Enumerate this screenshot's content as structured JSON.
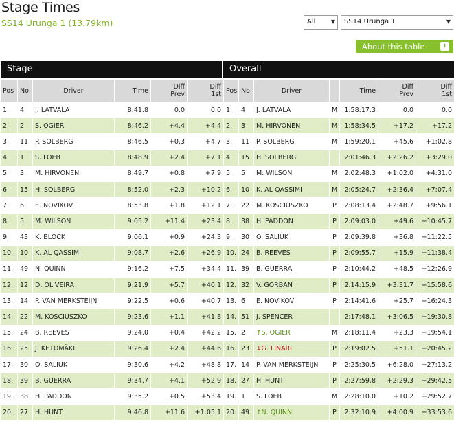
{
  "header": {
    "title": "Stage Times",
    "subtitle": "SS14 Urunga 1 (13.79km)",
    "filter_select": "All",
    "stage_select": "SS14 Urunga 1",
    "about_button": "About this table",
    "info_glyph": "i"
  },
  "stage_table": {
    "heading": "Stage",
    "columns": [
      "Pos",
      "No",
      "Driver",
      "Time",
      "Diff Prev",
      "Diff 1st"
    ],
    "rows": [
      {
        "pos": "1.",
        "no": "4",
        "driver": "J. LATVALA",
        "time": "8:41.8",
        "diff_prev": "0.0",
        "diff_first": "0.0"
      },
      {
        "pos": "2.",
        "no": "2",
        "driver": "S. OGIER",
        "time": "8:46.2",
        "diff_prev": "+4.4",
        "diff_first": "+4.4"
      },
      {
        "pos": "3.",
        "no": "11",
        "driver": "P. SOLBERG",
        "time": "8:46.5",
        "diff_prev": "+0.3",
        "diff_first": "+4.7"
      },
      {
        "pos": "4.",
        "no": "1",
        "driver": "S. LOEB",
        "time": "8:48.9",
        "diff_prev": "+2.4",
        "diff_first": "+7.1"
      },
      {
        "pos": "5.",
        "no": "3",
        "driver": "M. HIRVONEN",
        "time": "8:49.7",
        "diff_prev": "+0.8",
        "diff_first": "+7.9"
      },
      {
        "pos": "6.",
        "no": "15",
        "driver": "H. SOLBERG",
        "time": "8:52.0",
        "diff_prev": "+2.3",
        "diff_first": "+10.2"
      },
      {
        "pos": "7.",
        "no": "6",
        "driver": "E. NOVIKOV",
        "time": "8:53.8",
        "diff_prev": "+1.8",
        "diff_first": "+12.1"
      },
      {
        "pos": "8.",
        "no": "5",
        "driver": "M. WILSON",
        "time": "9:05.2",
        "diff_prev": "+11.4",
        "diff_first": "+23.4"
      },
      {
        "pos": "9.",
        "no": "43",
        "driver": "K. BLOCK",
        "time": "9:06.1",
        "diff_prev": "+0.9",
        "diff_first": "+24.3"
      },
      {
        "pos": "10.",
        "no": "10",
        "driver": "K. AL QASSIMI",
        "time": "9:08.7",
        "diff_prev": "+2.6",
        "diff_first": "+26.9"
      },
      {
        "pos": "11.",
        "no": "49",
        "driver": "N. QUINN",
        "time": "9:16.2",
        "diff_prev": "+7.5",
        "diff_first": "+34.4"
      },
      {
        "pos": "12.",
        "no": "12",
        "driver": "D. OLIVEIRA",
        "time": "9:21.9",
        "diff_prev": "+5.7",
        "diff_first": "+40.1"
      },
      {
        "pos": "13.",
        "no": "14",
        "driver": "P. VAN MERKSTEIJN",
        "time": "9:22.5",
        "diff_prev": "+0.6",
        "diff_first": "+40.7"
      },
      {
        "pos": "14.",
        "no": "22",
        "driver": "M. KOSCIUSZKO",
        "time": "9:23.6",
        "diff_prev": "+1.1",
        "diff_first": "+41.8"
      },
      {
        "pos": "15.",
        "no": "24",
        "driver": "B. REEVES",
        "time": "9:24.0",
        "diff_prev": "+0.4",
        "diff_first": "+42.2"
      },
      {
        "pos": "16.",
        "no": "25",
        "driver": "J. KETOMÄKI",
        "time": "9:26.4",
        "diff_prev": "+2.4",
        "diff_first": "+44.6"
      },
      {
        "pos": "17.",
        "no": "30",
        "driver": "O. SALIUK",
        "time": "9:30.6",
        "diff_prev": "+4.2",
        "diff_first": "+48.8"
      },
      {
        "pos": "18.",
        "no": "39",
        "driver": "B. GUERRA",
        "time": "9:34.7",
        "diff_prev": "+4.1",
        "diff_first": "+52.9"
      },
      {
        "pos": "19.",
        "no": "38",
        "driver": "H. PADDON",
        "time": "9:35.2",
        "diff_prev": "+0.5",
        "diff_first": "+53.4"
      },
      {
        "pos": "20.",
        "no": "27",
        "driver": "H. HUNT",
        "time": "9:46.8",
        "diff_prev": "+11.6",
        "diff_first": "+1:05.1"
      }
    ]
  },
  "overall_table": {
    "heading": "Overall",
    "columns": [
      "Pos",
      "No",
      "Driver",
      "",
      "Time",
      "Diff Prev",
      "Diff 1st"
    ],
    "rows": [
      {
        "pos": "1.",
        "no": "4",
        "driver": "J. LATVALA",
        "cls": "M",
        "time": "1:58:17.3",
        "diff_prev": "0.0",
        "diff_first": "0.0",
        "move": ""
      },
      {
        "pos": "2.",
        "no": "3",
        "driver": "M. HIRVONEN",
        "cls": "M",
        "time": "1:58:34.5",
        "diff_prev": "+17.2",
        "diff_first": "+17.2",
        "move": ""
      },
      {
        "pos": "3.",
        "no": "11",
        "driver": "P. SOLBERG",
        "cls": "M",
        "time": "1:59:20.1",
        "diff_prev": "+45.6",
        "diff_first": "+1:02.8",
        "move": ""
      },
      {
        "pos": "4.",
        "no": "15",
        "driver": "H. SOLBERG",
        "cls": "",
        "time": "2:01:46.3",
        "diff_prev": "+2:26.2",
        "diff_first": "+3:29.0",
        "move": ""
      },
      {
        "pos": "5.",
        "no": "5",
        "driver": "M. WILSON",
        "cls": "M",
        "time": "2:02:48.3",
        "diff_prev": "+1:02.0",
        "diff_first": "+4:31.0",
        "move": ""
      },
      {
        "pos": "6.",
        "no": "10",
        "driver": "K. AL QASSIMI",
        "cls": "M",
        "time": "2:05:24.7",
        "diff_prev": "+2:36.4",
        "diff_first": "+7:07.4",
        "move": ""
      },
      {
        "pos": "7.",
        "no": "22",
        "driver": "M. KOSCIUSZKO",
        "cls": "P",
        "time": "2:08:13.4",
        "diff_prev": "+2:48.7",
        "diff_first": "+9:56.1",
        "move": ""
      },
      {
        "pos": "8.",
        "no": "38",
        "driver": "H. PADDON",
        "cls": "P",
        "time": "2:09:03.0",
        "diff_prev": "+49.6",
        "diff_first": "+10:45.7",
        "move": ""
      },
      {
        "pos": "9.",
        "no": "30",
        "driver": "O. SALIUK",
        "cls": "P",
        "time": "2:09:39.8",
        "diff_prev": "+36.8",
        "diff_first": "+11:22.5",
        "move": ""
      },
      {
        "pos": "10.",
        "no": "24",
        "driver": "B. REEVES",
        "cls": "P",
        "time": "2:09:55.7",
        "diff_prev": "+15.9",
        "diff_first": "+11:38.4",
        "move": ""
      },
      {
        "pos": "11.",
        "no": "39",
        "driver": "B. GUERRA",
        "cls": "P",
        "time": "2:10:44.2",
        "diff_prev": "+48.5",
        "diff_first": "+12:26.9",
        "move": ""
      },
      {
        "pos": "12.",
        "no": "32",
        "driver": "V. GORBAN",
        "cls": "P",
        "time": "2:14:15.9",
        "diff_prev": "+3:31.7",
        "diff_first": "+15:58.6",
        "move": ""
      },
      {
        "pos": "13.",
        "no": "6",
        "driver": "E. NOVIKOV",
        "cls": "P",
        "time": "2:14:41.6",
        "diff_prev": "+25.7",
        "diff_first": "+16:24.3",
        "move": ""
      },
      {
        "pos": "14.",
        "no": "51",
        "driver": "J. SPENCER",
        "cls": "",
        "time": "2:17:48.1",
        "diff_prev": "+3:06.5",
        "diff_first": "+19:30.8",
        "move": ""
      },
      {
        "pos": "15.",
        "no": "2",
        "driver": "S. OGIER",
        "cls": "M",
        "time": "2:18:11.4",
        "diff_prev": "+23.3",
        "diff_first": "+19:54.1",
        "move": "up"
      },
      {
        "pos": "16.",
        "no": "23",
        "driver": "G. LINARI",
        "cls": "P",
        "time": "2:19:02.5",
        "diff_prev": "+51.1",
        "diff_first": "+20:45.2",
        "move": "down"
      },
      {
        "pos": "17.",
        "no": "14",
        "driver": "P. VAN MERKSTEIJN",
        "cls": "P",
        "time": "2:25:30.5",
        "diff_prev": "+6:28.0",
        "diff_first": "+27:13.2",
        "move": ""
      },
      {
        "pos": "18.",
        "no": "27",
        "driver": "H. HUNT",
        "cls": "P",
        "time": "2:27:59.8",
        "diff_prev": "+2:29.3",
        "diff_first": "+29:42.5",
        "move": ""
      },
      {
        "pos": "19.",
        "no": "1",
        "driver": "S. LOEB",
        "cls": "M",
        "time": "2:28:10.0",
        "diff_prev": "+10.2",
        "diff_first": "+29:52.7",
        "move": ""
      },
      {
        "pos": "20.",
        "no": "49",
        "driver": "N. QUINN",
        "cls": "P",
        "time": "2:32:10.9",
        "diff_prev": "+4:00.9",
        "diff_first": "+33:53.6",
        "move": "up"
      }
    ]
  },
  "colors": {
    "accent_green": "#87c02c",
    "row_alt": "#dfecc6",
    "header_bar": "#111111",
    "up": "#5a9a10",
    "down": "#b31515"
  }
}
